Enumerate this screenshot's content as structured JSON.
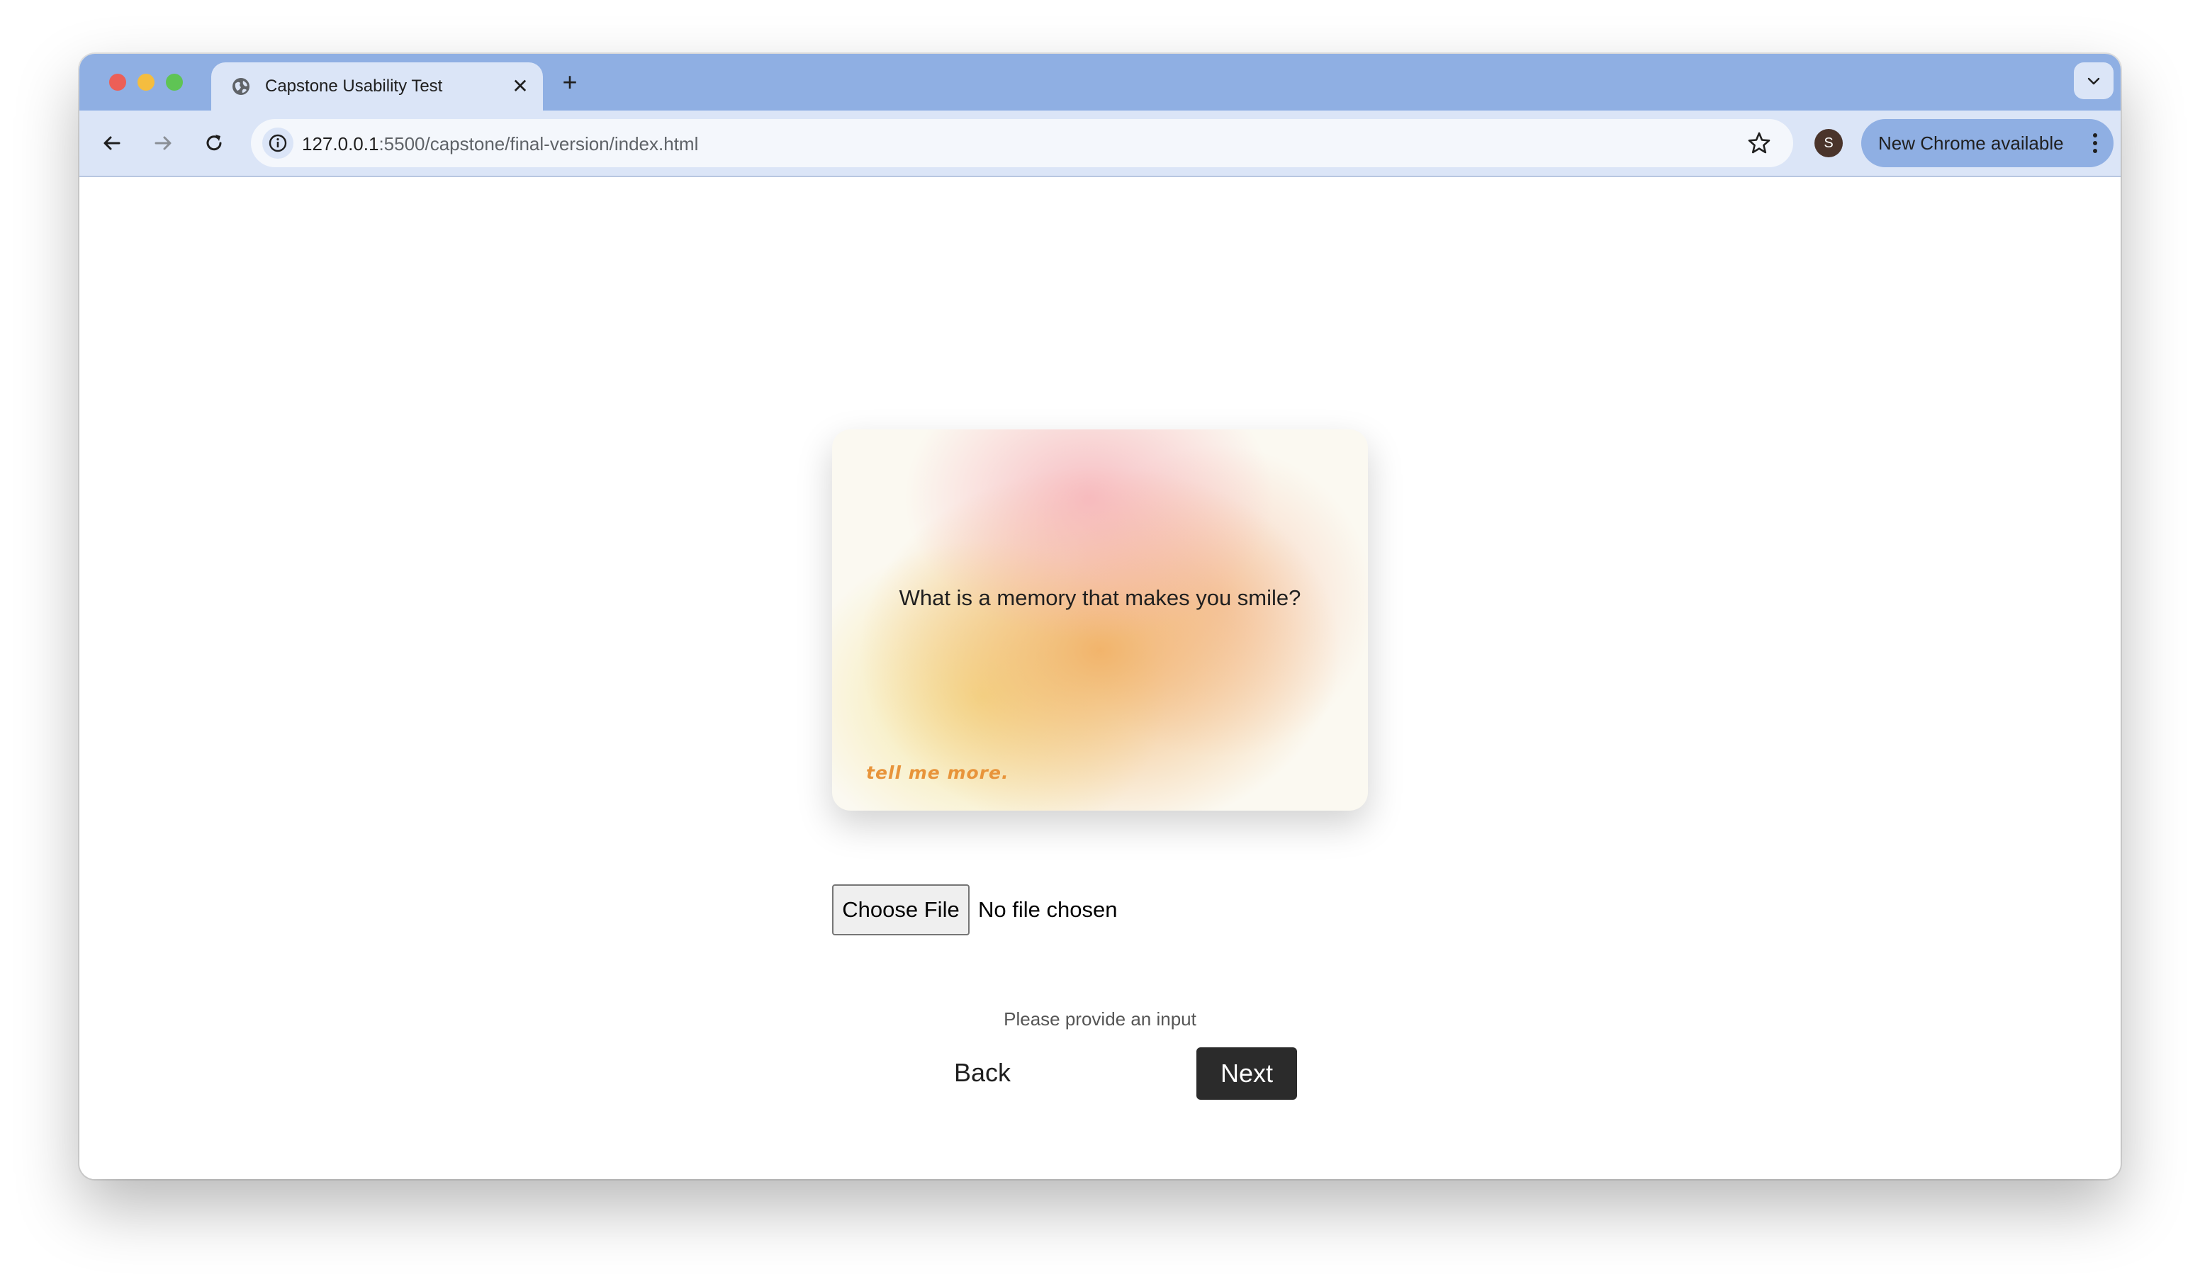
{
  "browser": {
    "tab": {
      "title": "Capstone Usability Test",
      "favicon": "globe-icon",
      "close_icon": "close-icon"
    },
    "new_tab_icon": "plus-icon",
    "tab_search_icon": "chevron-down-icon",
    "nav": {
      "back_icon": "arrow-left-icon",
      "forward_icon": "arrow-right-icon",
      "reload_icon": "reload-icon"
    },
    "address": {
      "info_icon": "info-icon",
      "host": "127.0.0.1",
      "path": ":5500/capstone/final-version/index.html",
      "bookmark_icon": "star-icon"
    },
    "profile_initial": "S",
    "update_button": {
      "label": "New Chrome available",
      "menu_icon": "kebab-menu-icon"
    },
    "colors": {
      "tab_strip": "#8fafe3",
      "toolbar": "#dbe5f7"
    }
  },
  "page": {
    "card": {
      "question": "What is a memory that makes you smile?",
      "tag": "tell me more.",
      "tag_color": "#e8943a"
    },
    "file_input": {
      "button_label": "Choose File",
      "status": "No file chosen"
    },
    "validation_message": "Please provide an input",
    "buttons": {
      "back": "Back",
      "next": "Next"
    }
  }
}
